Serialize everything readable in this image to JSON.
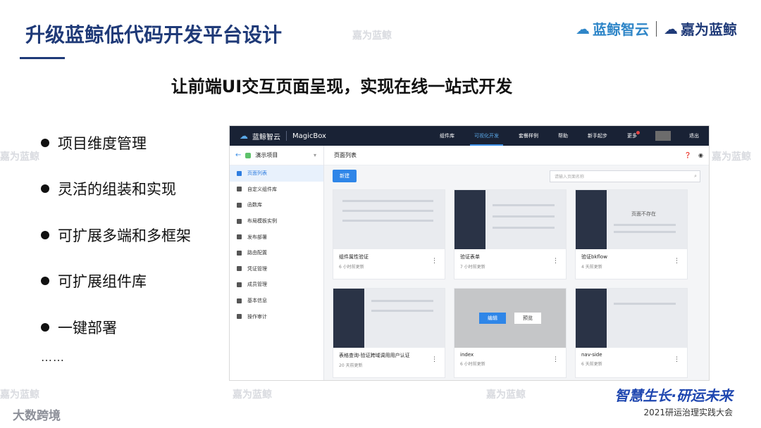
{
  "slide": {
    "title": "升级蓝鲸低代码开发平台设计",
    "subtitle": "让前端UI交互页面呈现，实现在线一站式开发",
    "logos": {
      "left": "蓝鲸智云",
      "right": "嘉为蓝鲸"
    },
    "bullets": [
      "项目维度管理",
      "灵活的组装和实现",
      "可扩展多端和多框架",
      "可扩展组件库",
      "一键部署"
    ],
    "ellipsis": "……",
    "watermark": "嘉为蓝鲸",
    "footer": {
      "brand": "智慧生长·研运未来",
      "event": "2021研运治理实践大会",
      "left_logo": "大数跨境"
    }
  },
  "app": {
    "nav": {
      "brand": "蓝鲸智云",
      "product": "MagicBox",
      "items": [
        "组件库",
        "可视化开发",
        "套餐样例",
        "帮助",
        "新手起步",
        "更多"
      ],
      "active": "可视化开发",
      "logout": "退出"
    },
    "sidebar": {
      "project": "演示项目",
      "items": [
        "页面列表",
        "自定义组件库",
        "函数库",
        "布局模板实例",
        "发布部署",
        "路由配置",
        "凭证管理",
        "成员管理",
        "基本信息",
        "操作审计"
      ],
      "active": "页面列表"
    },
    "main": {
      "title": "页面列表",
      "new_button": "新建",
      "search_placeholder": "请输入页面名称",
      "cards": [
        {
          "name": "组件属性验证",
          "meta": "6 小时前更新",
          "thumb": "light"
        },
        {
          "name": "验证表单",
          "meta": "7 小时前更新",
          "thumb": "dark"
        },
        {
          "name": "验证bkflow",
          "meta": "4 天前更新",
          "thumb": "error",
          "thumb_text": "页面不存在"
        },
        {
          "name": "表格查询-验证跨域调用用户认证",
          "meta": "20 天前更新",
          "thumb": "dark"
        },
        {
          "name": "index",
          "meta": "6 小时前更新",
          "thumb": "overlay",
          "edit": "编辑",
          "preview": "预览"
        },
        {
          "name": "nav-side",
          "meta": "6 天前更新",
          "thumb": "dark"
        }
      ]
    }
  }
}
